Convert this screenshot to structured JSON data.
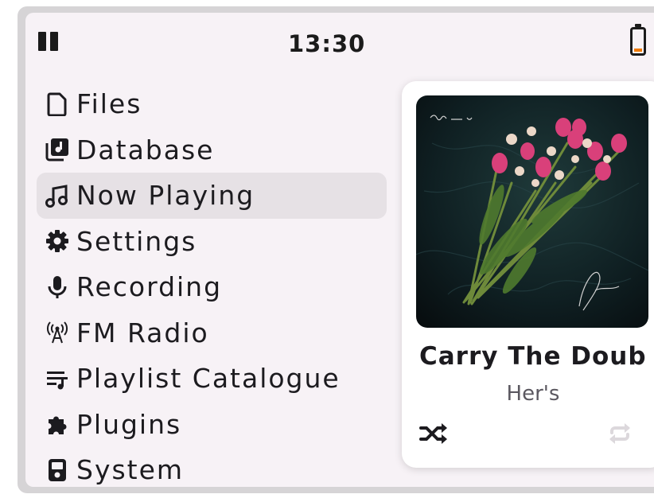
{
  "status": {
    "time": "13:30",
    "icons": [
      "pause-icon",
      "battery-icon"
    ],
    "battery_color": "#f07a00"
  },
  "menu": {
    "items": [
      {
        "label": "Files",
        "icon": "file-icon"
      },
      {
        "label": "Database",
        "icon": "database-icon"
      },
      {
        "label": "Now Playing",
        "icon": "music-note-icon",
        "active": true
      },
      {
        "label": "Settings",
        "icon": "gear-icon"
      },
      {
        "label": "Recording",
        "icon": "microphone-icon"
      },
      {
        "label": "FM Radio",
        "icon": "radio-antenna-icon"
      },
      {
        "label": "Playlist Catalogue",
        "icon": "playlist-icon"
      },
      {
        "label": "Plugins",
        "icon": "puzzle-icon"
      },
      {
        "label": "System",
        "icon": "device-icon"
      }
    ]
  },
  "now_playing": {
    "title": "Carry The Doub",
    "artist": "Her's",
    "album_art": "tulip-bouquet-album-art",
    "shuffle_icon": "shuffle-icon",
    "repeat_icon": "repeat-icon"
  },
  "colors": {
    "background": "#f7f2f6",
    "active_item": "#e6e1e5",
    "card": "#ffffff",
    "frame": "#d6d4d6"
  }
}
